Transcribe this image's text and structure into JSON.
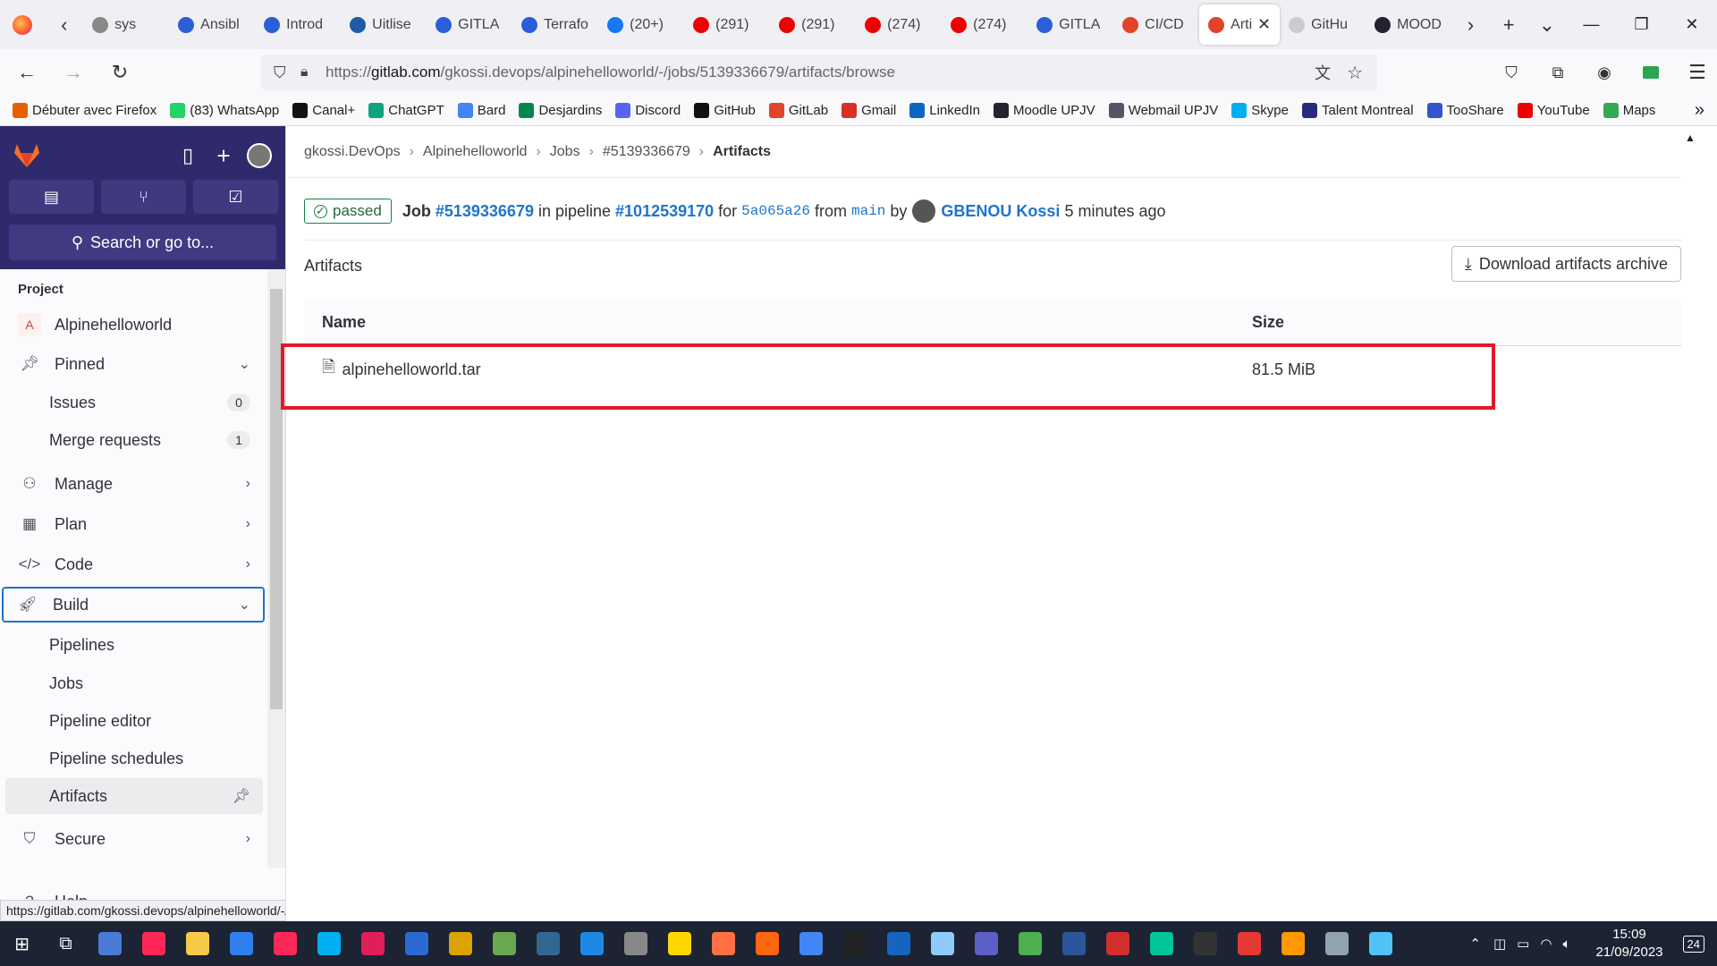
{
  "browser": {
    "tabs": [
      {
        "label": "sys",
        "color": "#888"
      },
      {
        "label": "Ansibl",
        "color": "#2b5fd9"
      },
      {
        "label": "Introd",
        "color": "#2b5fd9"
      },
      {
        "label": "Uitlise",
        "color": "#1e5aa8"
      },
      {
        "label": "GITLA",
        "color": "#2b5fd9"
      },
      {
        "label": "Terrafo",
        "color": "#2b5fd9"
      },
      {
        "label": "(20+)",
        "color": "#1877f2"
      },
      {
        "label": "(291)",
        "color": "#e00"
      },
      {
        "label": "(291)",
        "color": "#e00"
      },
      {
        "label": "(274)",
        "color": "#e00"
      },
      {
        "label": "(274)",
        "color": "#e00"
      },
      {
        "label": "GITLA",
        "color": "#2b5fd9"
      },
      {
        "label": "CI/CD",
        "color": "#e24329"
      },
      {
        "label": "Arti",
        "color": "#e24329",
        "active": true
      },
      {
        "label": "GitHu",
        "color": "#ccc"
      },
      {
        "label": "MOOD",
        "color": "#223"
      }
    ],
    "url_prefix": "https://",
    "url_host": "gitlab.com",
    "url_path": "/gkossi.devops/alpinehelloworld/-/jobs/5139336679/artifacts/browse",
    "bookmarks": [
      {
        "label": "Débuter avec Firefox",
        "color": "#e66000"
      },
      {
        "label": "(83) WhatsApp",
        "color": "#25d366"
      },
      {
        "label": "Canal+",
        "color": "#111"
      },
      {
        "label": "ChatGPT",
        "color": "#10a37f"
      },
      {
        "label": "Bard",
        "color": "#4285f4"
      },
      {
        "label": "Desjardins",
        "color": "#00874e"
      },
      {
        "label": "Discord",
        "color": "#5865f2"
      },
      {
        "label": "GitHub",
        "color": "#111"
      },
      {
        "label": "GitLab",
        "color": "#e24329"
      },
      {
        "label": "Gmail",
        "color": "#d93025"
      },
      {
        "label": "LinkedIn",
        "color": "#0a66c2"
      },
      {
        "label": "Moodle UPJV",
        "color": "#223"
      },
      {
        "label": "Webmail UPJV",
        "color": "#556"
      },
      {
        "label": "Skype",
        "color": "#00aff0"
      },
      {
        "label": "Talent Montreal",
        "color": "#2a2a7a"
      },
      {
        "label": "TooShare",
        "color": "#3355cc"
      },
      {
        "label": "YouTube",
        "color": "#e00"
      },
      {
        "label": "Maps",
        "color": "#34a853"
      }
    ],
    "status_url": "https://gitlab.com/gkossi.devops/alpinehelloworld/-/artifacts"
  },
  "sidebar": {
    "search_label": "Search or go to...",
    "section_label": "Project",
    "project_name": "Alpinehelloworld",
    "project_initial": "A",
    "pinned_label": "Pinned",
    "issues_label": "Issues",
    "issues_count": "0",
    "mr_label": "Merge requests",
    "mr_count": "1",
    "manage_label": "Manage",
    "plan_label": "Plan",
    "code_label": "Code",
    "build_label": "Build",
    "pipelines_label": "Pipelines",
    "jobs_label": "Jobs",
    "pipeline_editor_label": "Pipeline editor",
    "pipeline_schedules_label": "Pipeline schedules",
    "artifacts_label": "Artifacts",
    "secure_label": "Secure",
    "help_label": "Help"
  },
  "breadcrumb": {
    "items": [
      "gkossi.DevOps",
      "Alpinehelloworld",
      "Jobs",
      "#5139336679"
    ],
    "current": "Artifacts"
  },
  "job": {
    "status": "passed",
    "job_word": "Job",
    "job_id": "#5139336679",
    "in_pipeline": "in pipeline",
    "pipeline_id": "#1012539170",
    "for_word": "for",
    "commit": "5a065a26",
    "from_word": "from",
    "branch": "main",
    "by_word": "by",
    "author": "GBENOU Kossi",
    "time_ago": "5 minutes ago"
  },
  "artifacts": {
    "title": "Artifacts",
    "download_label": "Download artifacts archive",
    "col_name": "Name",
    "col_size": "Size",
    "rows": [
      {
        "name": "alpinehelloworld.tar",
        "size": "81.5 MiB"
      }
    ]
  },
  "taskbar": {
    "time": "15:09",
    "date": "21/09/2023",
    "notifications": "24"
  }
}
